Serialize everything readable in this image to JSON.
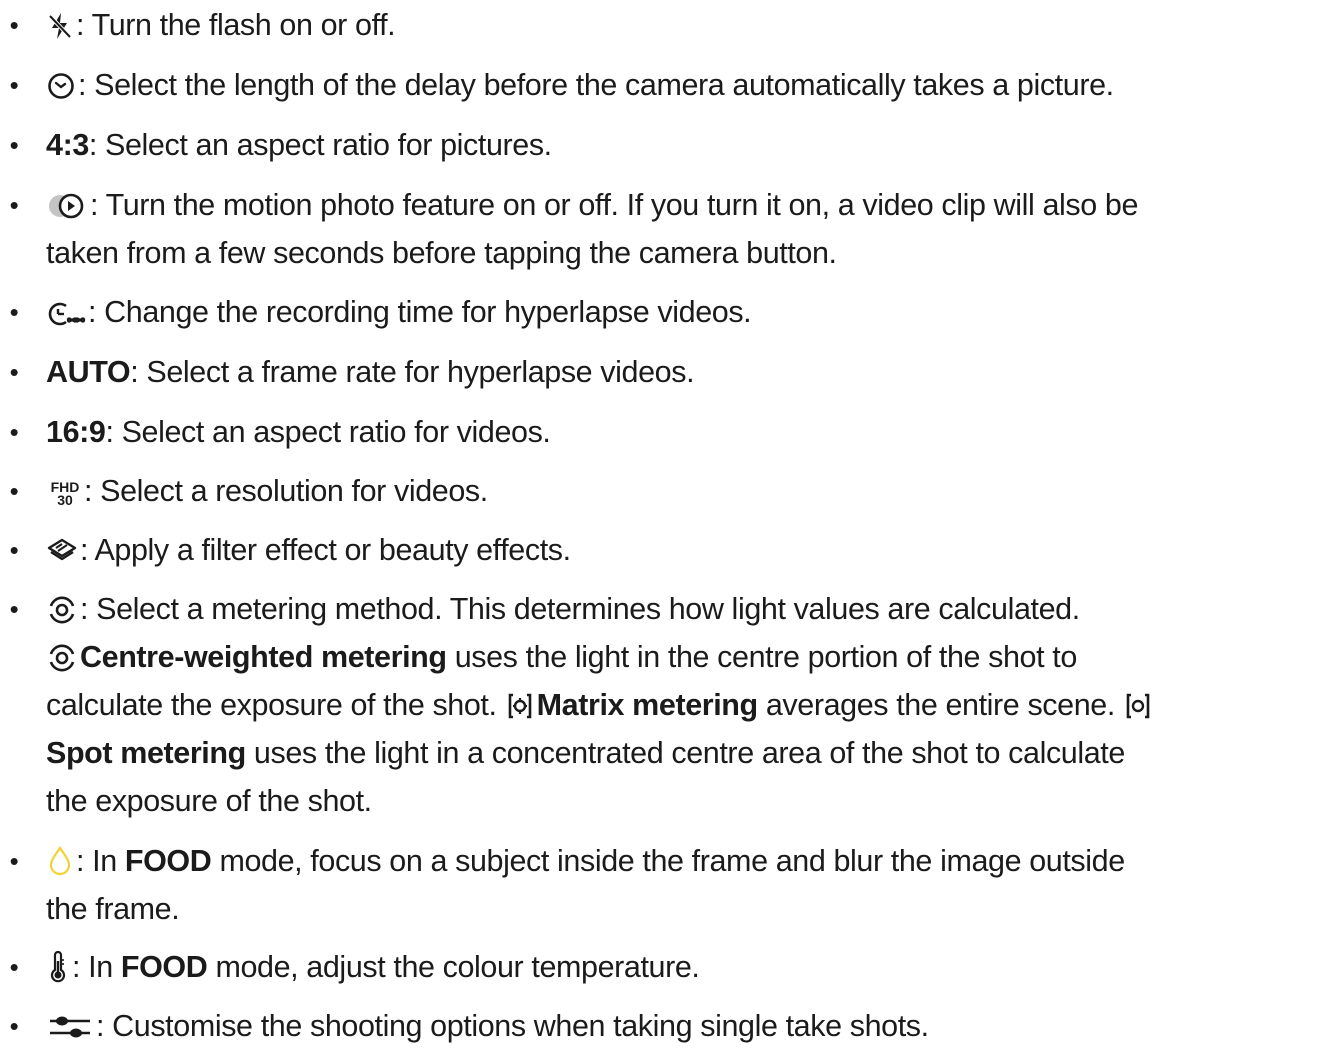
{
  "items": [
    {
      "icon": "flash-off-icon",
      "text": ": Turn the flash on or off."
    },
    {
      "icon": "timer-icon",
      "text": ": Select the length of the delay before the camera automatically takes a picture."
    },
    {
      "label": "4:3",
      "text": ": Select an aspect ratio for pictures."
    },
    {
      "icon": "motion-photo-icon",
      "line1": ": Turn the motion photo feature on or off. If you turn it on, a video clip will also be",
      "line2": "taken from a few seconds before tapping the camera button."
    },
    {
      "icon": "hyperlapse-time-icon",
      "text": ": Change the recording time for hyperlapse videos."
    },
    {
      "label": "AUTO",
      "text": ": Select a frame rate for hyperlapse videos."
    },
    {
      "label": "16:9",
      "text": ": Select an aspect ratio for videos."
    },
    {
      "icon_text_top": "FHD",
      "icon_text_bottom": "30",
      "text": ": Select a resolution for videos."
    },
    {
      "icon": "filter-layers-icon",
      "text": ": Apply a filter effect or beauty effects."
    },
    {
      "icon": "metering-icon",
      "text": ": Select a metering method. This determines how light values are calculated.",
      "cw_label": "Centre-weighted metering",
      "cw_text": "uses the light in the centre portion of the shot to",
      "cw_text2": "calculate the exposure of the shot.",
      "matrix_label": "Matrix metering",
      "matrix_text": "averages the entire scene.",
      "spot_label": "Spot metering",
      "spot_text": "uses the light in a concentrated centre area of the shot to calculate",
      "spot_text2": "the exposure of the shot."
    },
    {
      "icon": "focus-drop-icon",
      "pre": ": In",
      "mode": "FOOD",
      "line1": "mode, focus on a subject inside the frame and blur the image outside",
      "line2": "the frame."
    },
    {
      "icon": "thermometer-icon",
      "pre": ": In",
      "mode": "FOOD",
      "text": "mode, adjust the colour temperature."
    },
    {
      "icon": "sliders-icon",
      "text": ": Customise the shooting options when taking single take shots."
    }
  ],
  "colors": {
    "text": "#1b1b1b",
    "drop_icon": "#f2d233"
  }
}
